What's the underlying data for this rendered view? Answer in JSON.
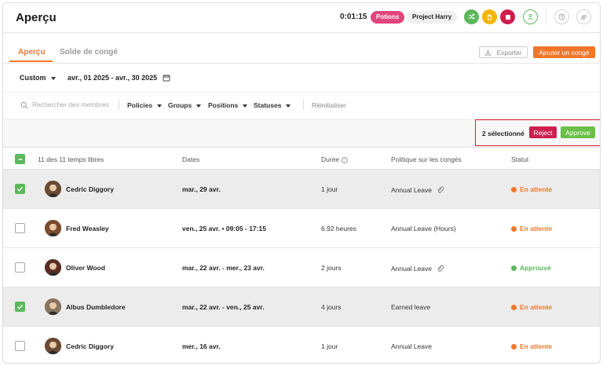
{
  "header": {
    "title": "Aperçu",
    "timer": "0:01:15",
    "task_pill": "Potions",
    "project_pill": "Project Harry"
  },
  "tabs": [
    {
      "label": "Aperçu",
      "active": true
    },
    {
      "label": "Solde de congé",
      "active": false
    }
  ],
  "toolbar": {
    "export_label": "Exporter",
    "add_label": "Ajouter un congé"
  },
  "date_filter": {
    "mode": "Custom",
    "range": "avr., 01 2025 - avr., 30 2025"
  },
  "filters": {
    "search_placeholder": "Rechercher des membres",
    "policies": "Policies",
    "groups": "Groups",
    "positions": "Positions",
    "statuses": "Statuses",
    "reset": "Réinitialiser"
  },
  "selection": {
    "count_label": "2 sélectionné",
    "reject_label": "Reject",
    "approve_label": "Approve"
  },
  "table": {
    "header": {
      "count": "11 des 11 temps libres",
      "dates": "Dates",
      "duration": "Durée",
      "policy": "Politique sur les congés",
      "status": "Statut"
    },
    "rows": [
      {
        "name": "Cedric Diggory",
        "dates": "mar., 29 avr.",
        "duration": "1 jour",
        "policy": "Annual Leave",
        "attachment": true,
        "status": "En attente",
        "status_color": "#f0772a",
        "selected": true
      },
      {
        "name": "Fred Weasley",
        "dates": "ven., 25 avr. • 09:05 - 17:15",
        "duration": "6.92 heures",
        "policy": "Annual Leave (Hours)",
        "attachment": false,
        "status": "En attente",
        "status_color": "#f0772a",
        "selected": false
      },
      {
        "name": "Oliver Wood",
        "dates": "mar., 22 avr. - mer., 23 avr.",
        "duration": "2 jours",
        "policy": "Annual Leave",
        "attachment": true,
        "status": "Approuvé",
        "status_color": "#5cb85c",
        "selected": false
      },
      {
        "name": "Albus Dumbledore",
        "dates": "mar., 22 avr. - ven., 25 avr.",
        "duration": "4 jours",
        "policy": "Earned leave",
        "attachment": false,
        "status": "En attente",
        "status_color": "#f0772a",
        "selected": true
      },
      {
        "name": "Cedric Diggory",
        "dates": "mer., 16 avr.",
        "duration": "1 jour",
        "policy": "Annual Leave",
        "attachment": false,
        "status": "En attente",
        "status_color": "#f0772a",
        "selected": false
      }
    ]
  },
  "colors": {
    "accent": "#f0772a",
    "approve": "#6cc04a",
    "reject": "#cf1e4e",
    "highlight_box": "#d8202a"
  }
}
